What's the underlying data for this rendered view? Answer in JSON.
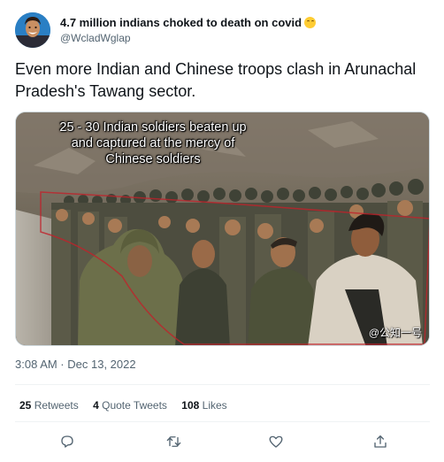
{
  "author": {
    "display_name": "4.7 million indians choked to death on covid",
    "emoji": "grinning-squinting-face-emoji",
    "handle": "@WcladWglap",
    "avatar": "user-avatar"
  },
  "tweet": {
    "text": "Even more Indian and Chinese troops clash in Arunachal Pradesh's Tawang sector."
  },
  "media": {
    "caption": "25 - 30 Indian soldiers beaten up and captured at the mercy of Chinese soldiers",
    "watermark": "@公知一号"
  },
  "meta": {
    "timestamp": "3:08 AM · Dec 13, 2022"
  },
  "stats": {
    "retweets_count": "25",
    "retweets_label": "Retweets",
    "quote_count": "4",
    "quote_label": "Quote Tweets",
    "likes_count": "108",
    "likes_label": "Likes"
  },
  "actions": [
    "reply-icon",
    "retweet-icon",
    "like-icon",
    "share-icon"
  ],
  "colors": {
    "text": "#0f1419",
    "secondary": "#536471",
    "divider": "#eff3f4",
    "overlay_outline": "#c0222a"
  }
}
